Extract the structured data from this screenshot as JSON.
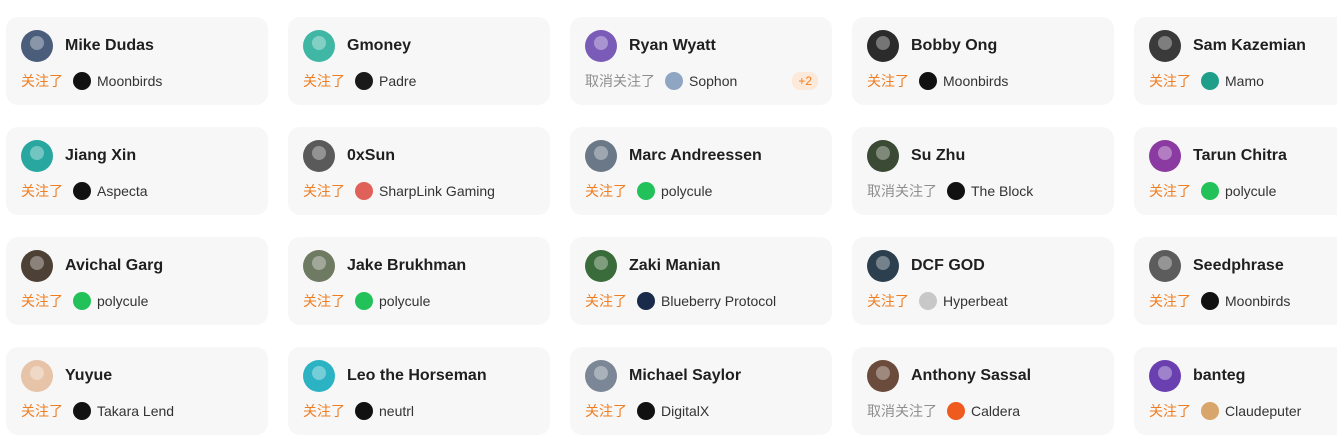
{
  "status_labels": {
    "follow": "关注了",
    "unfollow": "取消关注了"
  },
  "colors": {
    "follow": "#ef7d22",
    "unfollow": "#8e8e8e",
    "card_bg": "#f7f7f7"
  },
  "cards": [
    {
      "name": "Mike Dudas",
      "status": "follow",
      "project": "Moonbirds",
      "avatar_color": "#4a5d7a",
      "project_icon": "moonbirds-icon",
      "project_icon_color": "#111111"
    },
    {
      "name": "Gmoney",
      "status": "follow",
      "project": "Padre",
      "avatar_color": "#3fb7a4",
      "project_icon": "padre-icon",
      "project_icon_color": "#1a1a1a"
    },
    {
      "name": "Ryan Wyatt",
      "status": "unfollow",
      "project": "Sophon",
      "extra": "+2",
      "avatar_color": "#7b5bb8",
      "project_icon": "sophon-icon",
      "project_icon_color": "#8fa6c2"
    },
    {
      "name": "Bobby Ong",
      "status": "follow",
      "project": "Moonbirds",
      "avatar_color": "#2b2b2b",
      "project_icon": "moonbirds-icon",
      "project_icon_color": "#111111"
    },
    {
      "name": "Sam Kazemian",
      "status": "follow",
      "project": "Mamo",
      "avatar_color": "#3a3a3a",
      "project_icon": "mamo-icon",
      "project_icon_color": "#1f9e8a"
    },
    {
      "name": "Jiang Xin",
      "status": "follow",
      "project": "Aspecta",
      "avatar_color": "#27a7a0",
      "project_icon": "aspecta-icon",
      "project_icon_color": "#111111"
    },
    {
      "name": "0xSun",
      "status": "follow",
      "project": "SharpLink Gaming",
      "avatar_color": "#5a5a5a",
      "project_icon": "sharplink-icon",
      "project_icon_color": "#e0615a"
    },
    {
      "name": "Marc Andreessen",
      "status": "follow",
      "project": "polycule",
      "avatar_color": "#6b7888",
      "project_icon": "polycule-icon",
      "project_icon_color": "#23c15a"
    },
    {
      "name": "Su Zhu",
      "status": "unfollow",
      "project": "The Block",
      "avatar_color": "#3b4a34",
      "project_icon": "the-block-icon",
      "project_icon_color": "#111111"
    },
    {
      "name": "Tarun Chitra",
      "status": "follow",
      "project": "polycule",
      "avatar_color": "#8a3aa0",
      "project_icon": "polycule-icon",
      "project_icon_color": "#23c15a"
    },
    {
      "name": "Avichal Garg",
      "status": "follow",
      "project": "polycule",
      "avatar_color": "#4d4035",
      "project_icon": "polycule-icon",
      "project_icon_color": "#23c15a"
    },
    {
      "name": "Jake Brukhman",
      "status": "follow",
      "project": "polycule",
      "avatar_color": "#6f7a63",
      "project_icon": "polycule-icon",
      "project_icon_color": "#23c15a"
    },
    {
      "name": "Zaki Manian",
      "status": "follow",
      "project": "Blueberry Protocol",
      "avatar_color": "#3a6b3a",
      "project_icon": "blueberry-icon",
      "project_icon_color": "#1a2a4a"
    },
    {
      "name": "DCF GOD",
      "status": "follow",
      "project": "Hyperbeat",
      "avatar_color": "#2c3f4f",
      "project_icon": "hyperbeat-icon",
      "project_icon_color": "#c8c8c8"
    },
    {
      "name": "Seedphrase",
      "status": "follow",
      "project": "Moonbirds",
      "avatar_color": "#5c5c5c",
      "project_icon": "moonbirds-icon",
      "project_icon_color": "#111111"
    },
    {
      "name": "Yuyue",
      "status": "follow",
      "project": "Takara Lend",
      "avatar_color": "#e7c3a8",
      "project_icon": "takara-icon",
      "project_icon_color": "#111111"
    },
    {
      "name": "Leo the Horseman",
      "status": "follow",
      "project": "neutrl",
      "avatar_color": "#2bb3c4",
      "project_icon": "neutrl-icon",
      "project_icon_color": "#111111"
    },
    {
      "name": "Michael Saylor",
      "status": "follow",
      "project": "DigitalX",
      "avatar_color": "#7b8796",
      "project_icon": "digitalx-icon",
      "project_icon_color": "#111111"
    },
    {
      "name": "Anthony Sassal",
      "status": "unfollow",
      "project": "Caldera",
      "avatar_color": "#6b4b3b",
      "project_icon": "caldera-icon",
      "project_icon_color": "#ef5a1e"
    },
    {
      "name": "banteg",
      "status": "follow",
      "project": "Claudeputer",
      "avatar_color": "#6a3fb0",
      "project_icon": "claudeputer-icon",
      "project_icon_color": "#d8a56a"
    }
  ]
}
